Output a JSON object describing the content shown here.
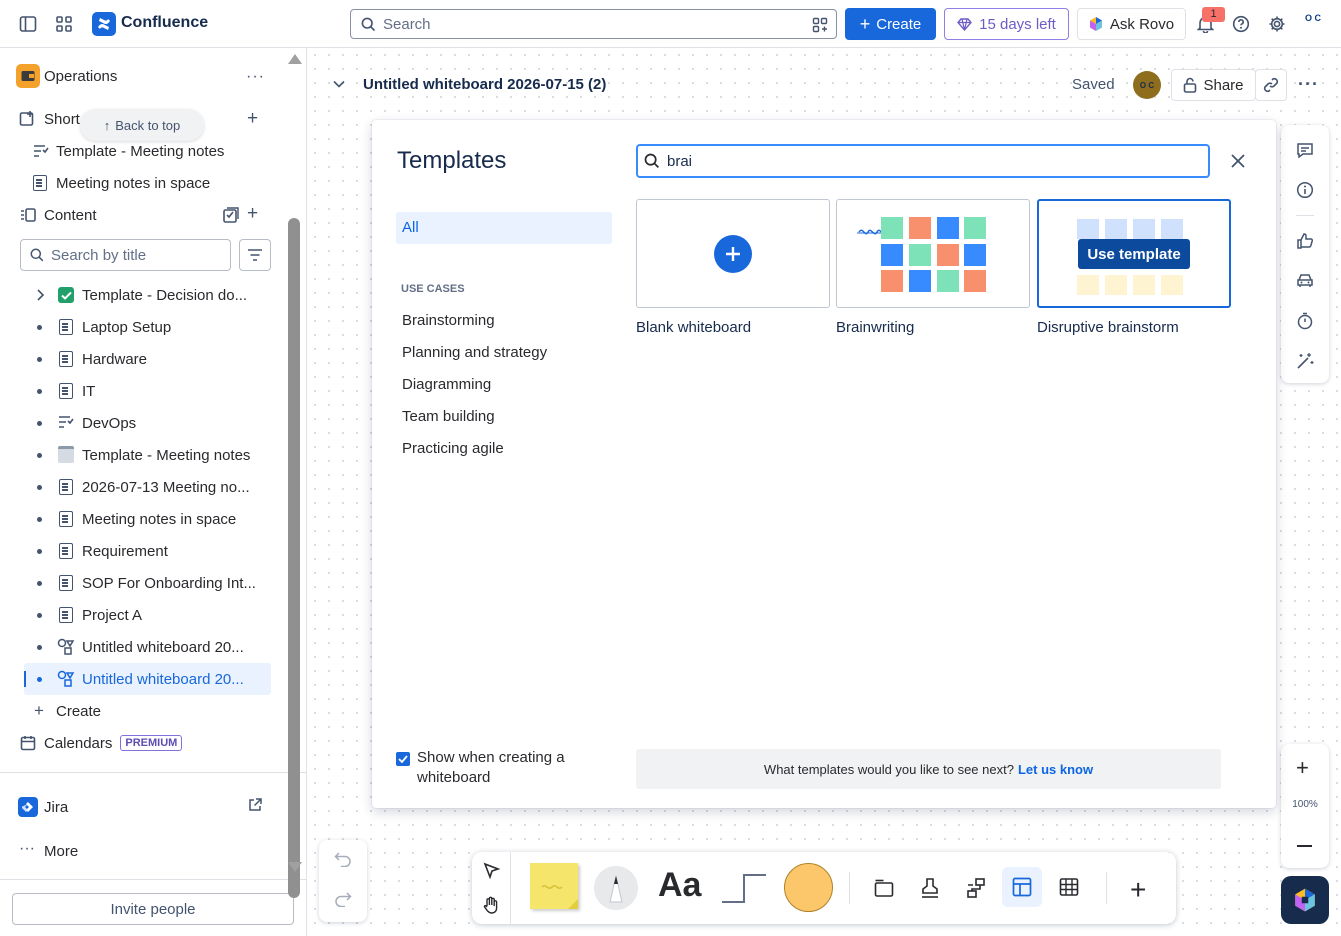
{
  "topbar": {
    "app_name": "Confluence",
    "search_placeholder": "Search",
    "create_label": "Create",
    "trial_label": "15 days left",
    "rovo_label": "Ask Rovo",
    "notification_count": "1",
    "avatar_initials": "O C",
    "accent_color": "#1868db"
  },
  "sidebar": {
    "space_name": "Operations",
    "shortcuts_label": "Short",
    "back_to_top": "Back to top",
    "shortcuts": [
      "Template - Meeting notes",
      "Meeting notes in space"
    ],
    "content_label": "Content",
    "search_placeholder": "Search by title",
    "tree": [
      "Template - Decision do...",
      "Laptop Setup",
      "Hardware",
      "IT",
      "DevOps",
      "Template - Meeting notes",
      "2026-07-13 Meeting no...",
      "Meeting notes in space",
      "Requirement",
      "SOP For Onboarding Int...",
      "Project A",
      "Untitled whiteboard 20...",
      "Untitled whiteboard 20..."
    ],
    "create_label": "Create",
    "calendars_label": "Calendars",
    "premium_badge": "PREMIUM",
    "jira_label": "Jira",
    "more_label": "More",
    "invite_label": "Invite people"
  },
  "whiteboard": {
    "title": "Untitled whiteboard 2026-07-15 (2)",
    "status": "Saved",
    "share_label": "Share",
    "zoom": "100%"
  },
  "templates_modal": {
    "title": "Templates",
    "search_value": "brai",
    "all_label": "All",
    "use_cases_heading": "USE CASES",
    "categories": [
      "Brainstorming",
      "Planning and strategy",
      "Diagramming",
      "Team building",
      "Practicing agile"
    ],
    "cards": [
      "Blank whiteboard",
      "Brainwriting",
      "Disruptive brainstorm"
    ],
    "use_template_label": "Use template",
    "show_when_creating": "Show when creating a whiteboard",
    "feedback_text": "What templates would you like to see next?",
    "feedback_link": "Let us know"
  }
}
